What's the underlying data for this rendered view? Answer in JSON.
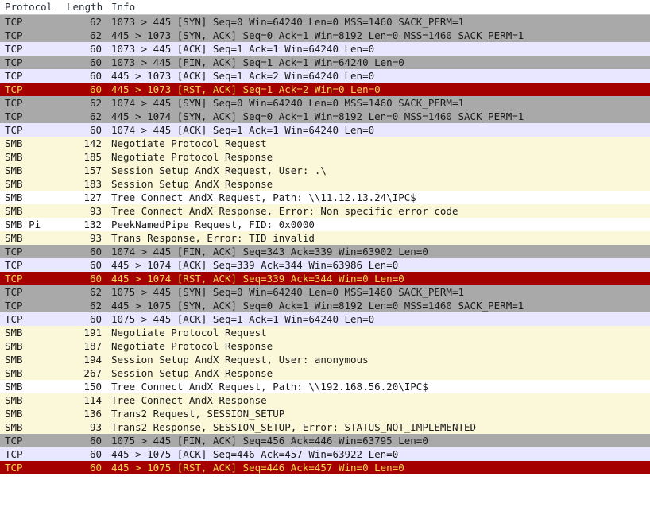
{
  "columns": {
    "protocol": "Protocol",
    "length": "Length",
    "info": "Info"
  },
  "rows": [
    {
      "cls": "grey",
      "protocol": "TCP",
      "length": "62",
      "info": "1073 > 445 [SYN] Seq=0 Win=64240 Len=0 MSS=1460 SACK_PERM=1"
    },
    {
      "cls": "grey",
      "protocol": "TCP",
      "length": "62",
      "info": "445 > 1073 [SYN, ACK] Seq=0 Ack=1 Win=8192 Len=0 MSS=1460 SACK_PERM=1"
    },
    {
      "cls": "lav",
      "protocol": "TCP",
      "length": "60",
      "info": "1073 > 445 [ACK] Seq=1 Ack=1 Win=64240 Len=0"
    },
    {
      "cls": "grey",
      "protocol": "TCP",
      "length": "60",
      "info": "1073 > 445 [FIN, ACK] Seq=1 Ack=1 Win=64240 Len=0"
    },
    {
      "cls": "lav",
      "protocol": "TCP",
      "length": "60",
      "info": "445 > 1073 [ACK] Seq=1 Ack=2 Win=64240 Len=0"
    },
    {
      "cls": "red",
      "protocol": "TCP",
      "length": "60",
      "info": "445 > 1073 [RST, ACK] Seq=1 Ack=2 Win=0 Len=0"
    },
    {
      "cls": "grey",
      "protocol": "TCP",
      "length": "62",
      "info": "1074 > 445 [SYN] Seq=0 Win=64240 Len=0 MSS=1460 SACK_PERM=1"
    },
    {
      "cls": "grey",
      "protocol": "TCP",
      "length": "62",
      "info": "445 > 1074 [SYN, ACK] Seq=0 Ack=1 Win=8192 Len=0 MSS=1460 SACK_PERM=1"
    },
    {
      "cls": "lav",
      "protocol": "TCP",
      "length": "60",
      "info": "1074 > 445 [ACK] Seq=1 Ack=1 Win=64240 Len=0"
    },
    {
      "cls": "yel",
      "protocol": "SMB",
      "length": "142",
      "info": "Negotiate Protocol Request"
    },
    {
      "cls": "yel",
      "protocol": "SMB",
      "length": "185",
      "info": "Negotiate Protocol Response"
    },
    {
      "cls": "yel",
      "protocol": "SMB",
      "length": "157",
      "info": "Session Setup AndX Request, User: .\\"
    },
    {
      "cls": "yel",
      "protocol": "SMB",
      "length": "183",
      "info": "Session Setup AndX Response"
    },
    {
      "cls": "wht",
      "protocol": "SMB",
      "length": "127",
      "info": "Tree Connect AndX Request, Path: \\\\11.12.13.24\\IPC$"
    },
    {
      "cls": "yel",
      "protocol": "SMB",
      "length": "93",
      "info": "Tree Connect AndX Response, Error: Non specific error code"
    },
    {
      "cls": "wht",
      "protocol": "SMB Pi",
      "length": "132",
      "info": "PeekNamedPipe Request, FID: 0x0000"
    },
    {
      "cls": "yel",
      "protocol": "SMB",
      "length": "93",
      "info": "Trans Response, Error: TID invalid"
    },
    {
      "cls": "grey",
      "protocol": "TCP",
      "length": "60",
      "info": "1074 > 445 [FIN, ACK] Seq=343 Ack=339 Win=63902 Len=0"
    },
    {
      "cls": "lav",
      "protocol": "TCP",
      "length": "60",
      "info": "445 > 1074 [ACK] Seq=339 Ack=344 Win=63986 Len=0"
    },
    {
      "cls": "red",
      "protocol": "TCP",
      "length": "60",
      "info": "445 > 1074 [RST, ACK] Seq=339 Ack=344 Win=0 Len=0"
    },
    {
      "cls": "grey",
      "protocol": "TCP",
      "length": "62",
      "info": "1075 > 445 [SYN] Seq=0 Win=64240 Len=0 MSS=1460 SACK_PERM=1"
    },
    {
      "cls": "grey",
      "protocol": "TCP",
      "length": "62",
      "info": "445 > 1075 [SYN, ACK] Seq=0 Ack=1 Win=8192 Len=0 MSS=1460 SACK_PERM=1"
    },
    {
      "cls": "lav",
      "protocol": "TCP",
      "length": "60",
      "info": "1075 > 445 [ACK] Seq=1 Ack=1 Win=64240 Len=0"
    },
    {
      "cls": "yel",
      "protocol": "SMB",
      "length": "191",
      "info": "Negotiate Protocol Request"
    },
    {
      "cls": "yel",
      "protocol": "SMB",
      "length": "187",
      "info": "Negotiate Protocol Response"
    },
    {
      "cls": "yel",
      "protocol": "SMB",
      "length": "194",
      "info": "Session Setup AndX Request, User: anonymous"
    },
    {
      "cls": "yel",
      "protocol": "SMB",
      "length": "267",
      "info": "Session Setup AndX Response"
    },
    {
      "cls": "wht",
      "protocol": "SMB",
      "length": "150",
      "info": "Tree Connect AndX Request, Path: \\\\192.168.56.20\\IPC$"
    },
    {
      "cls": "yel",
      "protocol": "SMB",
      "length": "114",
      "info": "Tree Connect AndX Response"
    },
    {
      "cls": "yel",
      "protocol": "SMB",
      "length": "136",
      "info": "Trans2 Request, SESSION_SETUP"
    },
    {
      "cls": "yel",
      "protocol": "SMB",
      "length": "93",
      "info": "Trans2 Response, SESSION_SETUP, Error: STATUS_NOT_IMPLEMENTED"
    },
    {
      "cls": "grey",
      "protocol": "TCP",
      "length": "60",
      "info": "1075 > 445 [FIN, ACK] Seq=456 Ack=446 Win=63795 Len=0"
    },
    {
      "cls": "lav",
      "protocol": "TCP",
      "length": "60",
      "info": "445 > 1075 [ACK] Seq=446 Ack=457 Win=63922 Len=0"
    },
    {
      "cls": "red",
      "protocol": "TCP",
      "length": "60",
      "info": "445 > 1075 [RST, ACK] Seq=446 Ack=457 Win=0 Len=0"
    }
  ]
}
